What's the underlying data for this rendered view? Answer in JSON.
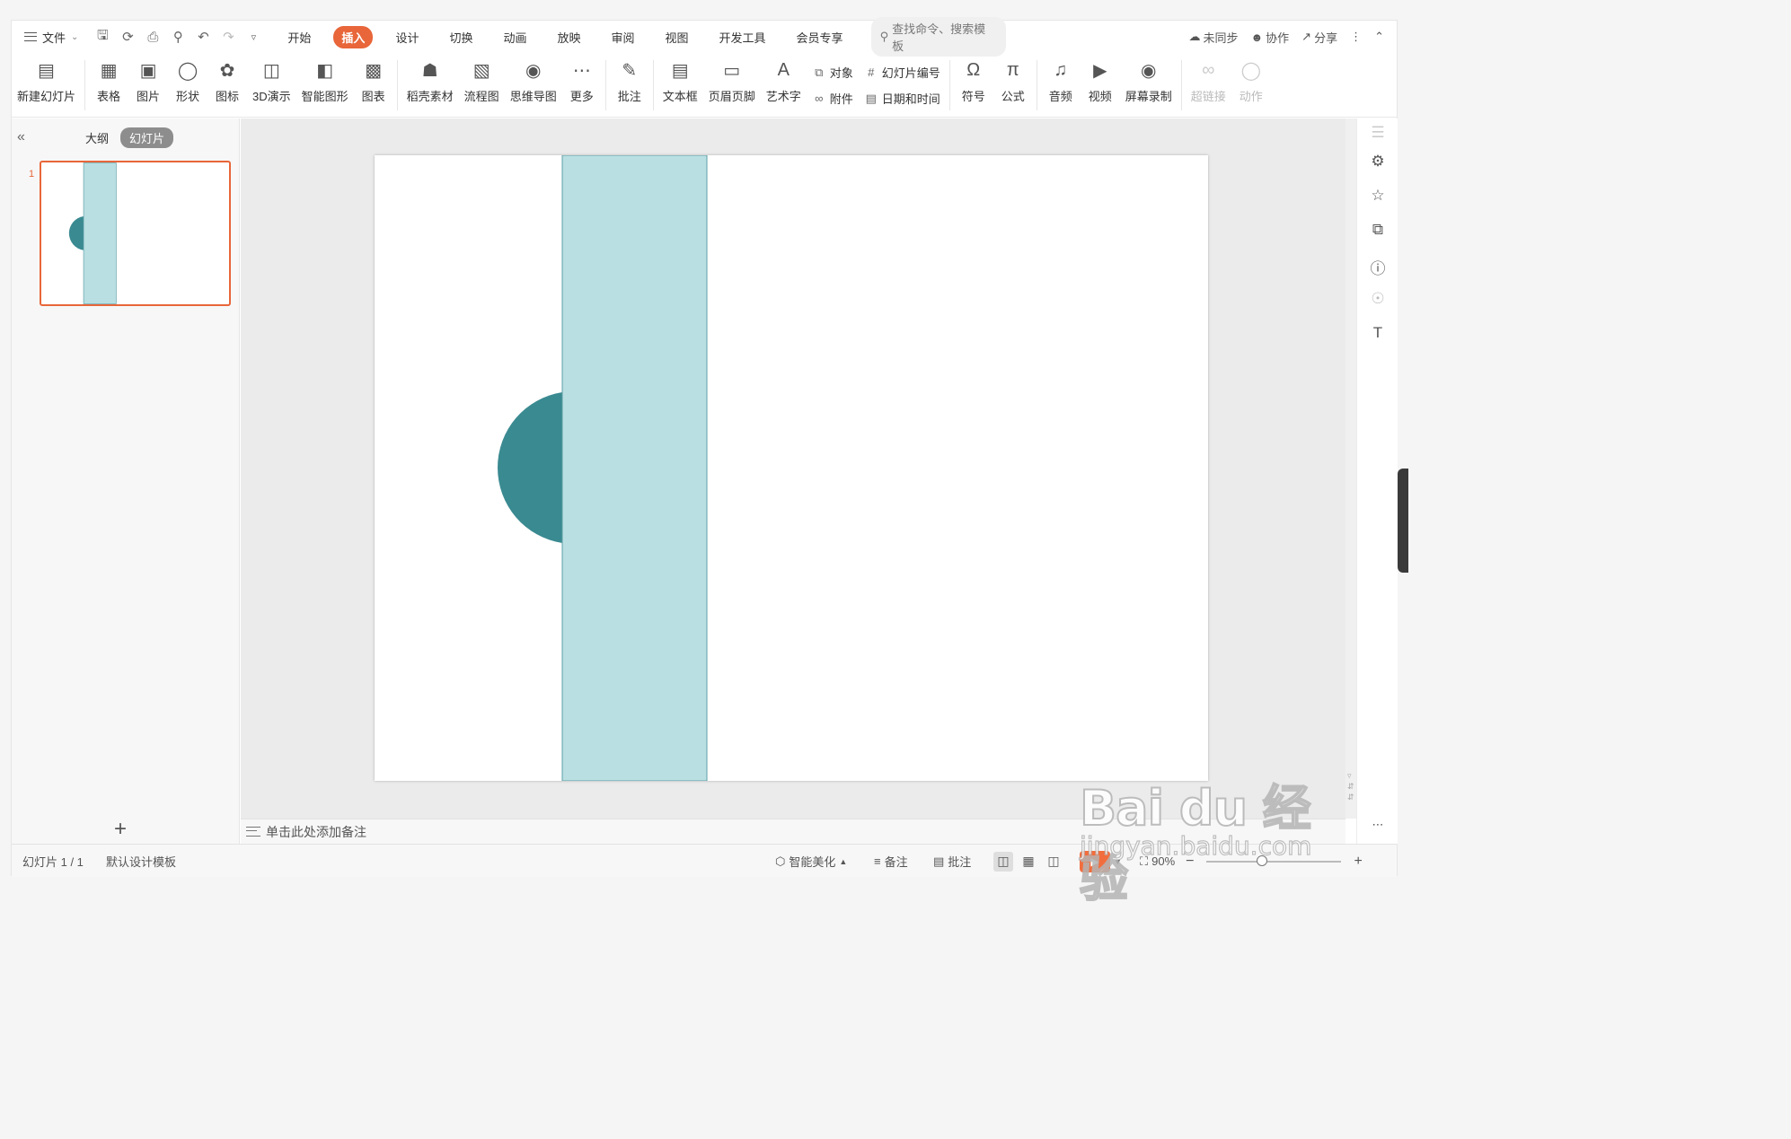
{
  "menubar": {
    "file_label": "文件",
    "tabs": [
      {
        "label": "开始",
        "active": false
      },
      {
        "label": "插入",
        "active": true
      },
      {
        "label": "设计",
        "active": false
      },
      {
        "label": "切换",
        "active": false
      },
      {
        "label": "动画",
        "active": false
      },
      {
        "label": "放映",
        "active": false
      },
      {
        "label": "审阅",
        "active": false
      },
      {
        "label": "视图",
        "active": false
      },
      {
        "label": "开发工具",
        "active": false
      },
      {
        "label": "会员专享",
        "active": false
      }
    ],
    "search_placeholder": "查找命令、搜索模板",
    "sync_label": "未同步",
    "collab_label": "协作",
    "share_label": "分享"
  },
  "ribbon": {
    "new_slide": "新建幻灯片",
    "table": "表格",
    "picture": "图片",
    "shape": "形状",
    "icon": "图标",
    "demo3d": "3D演示",
    "smartart": "智能图形",
    "chart": "图表",
    "docer": "稻壳素材",
    "flowchart": "流程图",
    "mindmap": "思维导图",
    "more": "更多",
    "comment": "批注",
    "textbox": "文本框",
    "header_footer": "页眉页脚",
    "wordart": "艺术字",
    "object": "对象",
    "attachment": "附件",
    "slide_number": "幻灯片编号",
    "datetime": "日期和时间",
    "symbol": "符号",
    "formula": "公式",
    "audio": "音频",
    "video": "视频",
    "screen_record": "屏幕录制",
    "hyperlink": "超链接",
    "action": "动作"
  },
  "left_panel": {
    "outline_tab": "大纲",
    "slides_tab": "幻灯片",
    "slide_number": "1"
  },
  "slide": {
    "rect_fill": "#b9dfe2",
    "rect_stroke": "#5e9fa6",
    "semicircle_fill": "#3a8a91"
  },
  "notes": {
    "placeholder": "单击此处添加备注"
  },
  "statusbar": {
    "slide_counter": "幻灯片 1 / 1",
    "template": "默认设计模板",
    "beautify": "智能美化",
    "notes_btn": "备注",
    "comment_btn": "批注",
    "zoom": "90%"
  },
  "watermark": {
    "logo": "Bai du 经验",
    "url": "jingyan.baidu.com"
  },
  "colors": {
    "accent": "#e8663a"
  }
}
